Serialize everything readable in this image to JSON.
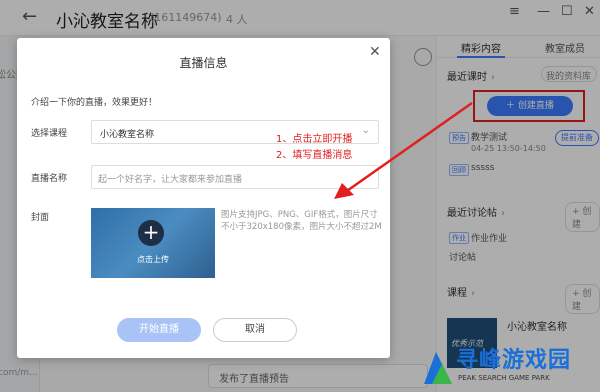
{
  "header": {
    "back_icon": "back-arrow-icon",
    "title": "小沁教室名称",
    "class_id": "(161149674)",
    "members": "4 人",
    "window_controls": [
      "menu-icon",
      "minimize-icon",
      "maximize-icon",
      "close-icon"
    ]
  },
  "left_strip": {
    "text_top": "松公图",
    "text_bottom": "com/m..."
  },
  "center": {
    "bottom_message": "发布了直播预告"
  },
  "right_panel": {
    "tabs": [
      "精彩内容",
      "教室成员"
    ],
    "recent_lessons": "最近课时",
    "my_library": "我的资料库",
    "create_live": "创建直播",
    "lesson_tag": "预告",
    "lesson_name": "教学测试",
    "lesson_time": "04-25 13:50-14:50",
    "prep_button": "提前准备",
    "playback_tag": "回顾",
    "playback_name": "sssss",
    "recent_discussion": "最近讨论帖",
    "add_label": "+ 创建",
    "homework_tag": "作业",
    "homework_text": "作业作业",
    "discussion_post": "讨论帖",
    "course_label": "课程",
    "course_name": "小沁教室名称",
    "thumb_text": "优秀示范"
  },
  "modal": {
    "title": "直播信息",
    "close_icon": "close-icon",
    "intro": "介绍一下你的直播，效果更好！",
    "course_label": "选择课程",
    "course_value": "小沁教室名称",
    "name_label": "直播名称",
    "name_placeholder": "起一个好名字，让大家都来参加直播",
    "cover_label": "封面",
    "upload_text": "点击上传",
    "cover_hint_line1": "图片支持JPG、PNG、GIF格式，图片尺寸",
    "cover_hint_line2": "不小于320x180像素，图片大小不超过2M",
    "start_button": "开始直播",
    "cancel_button": "取消"
  },
  "annotations": {
    "step1": "1、点击立即开播",
    "step2": "2、填写直播消息"
  },
  "watermark": {
    "title": "寻峰游戏园",
    "subtitle": "PEAK SEARCH GAME PARK"
  },
  "colors": {
    "accent": "#3d7dff",
    "annotation_red": "#e02020"
  }
}
